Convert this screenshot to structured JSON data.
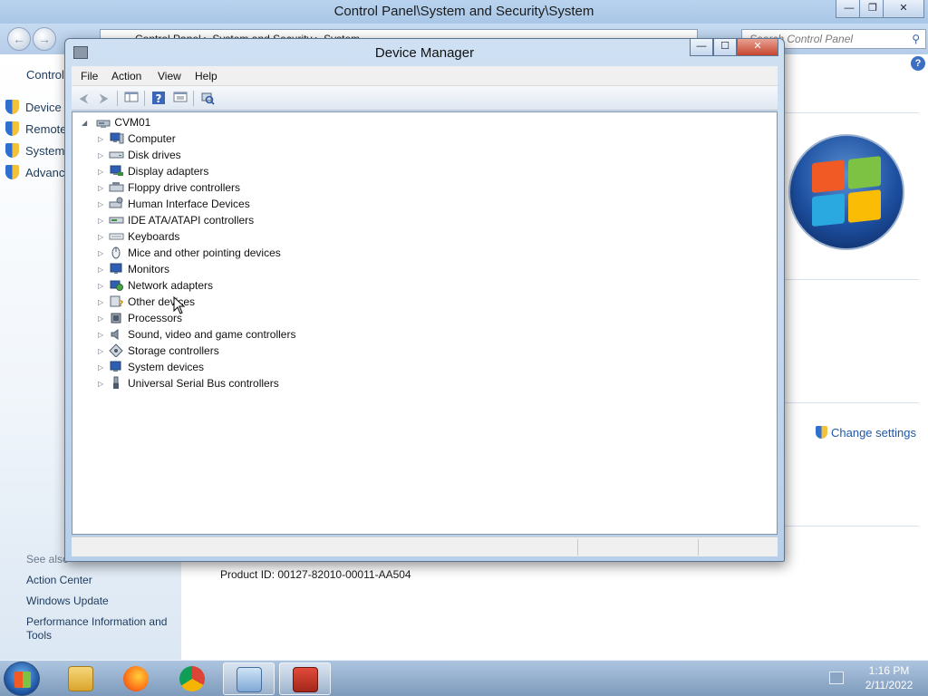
{
  "control_panel": {
    "title": "Control Panel\\System and Security\\System",
    "breadcrumb": [
      "Control Panel",
      "System and Security",
      "System"
    ],
    "search_placeholder": "Search Control Panel",
    "sidebar": {
      "home": "Control",
      "items": [
        "Device M",
        "Remote",
        "System",
        "Advanc"
      ],
      "see_also": "See also",
      "links": [
        "Action Center",
        "Windows Update",
        "Performance Information and Tools"
      ]
    },
    "change_settings": "Change settings",
    "product_id": "Product ID: 00127-82010-00011-AA504"
  },
  "device_manager": {
    "title": "Device Manager",
    "menu": [
      "File",
      "Action",
      "View",
      "Help"
    ],
    "root": "CVM01",
    "categories": [
      {
        "label": "Computer",
        "icon": "computer-icon"
      },
      {
        "label": "Disk drives",
        "icon": "disk-drive-icon"
      },
      {
        "label": "Display adapters",
        "icon": "display-adapter-icon"
      },
      {
        "label": "Floppy drive controllers",
        "icon": "floppy-controller-icon"
      },
      {
        "label": "Human Interface Devices",
        "icon": "hid-icon"
      },
      {
        "label": "IDE ATA/ATAPI controllers",
        "icon": "ide-controller-icon"
      },
      {
        "label": "Keyboards",
        "icon": "keyboard-icon"
      },
      {
        "label": "Mice and other pointing devices",
        "icon": "mouse-icon"
      },
      {
        "label": "Monitors",
        "icon": "monitor-icon"
      },
      {
        "label": "Network adapters",
        "icon": "network-adapter-icon"
      },
      {
        "label": "Other devices",
        "icon": "other-devices-icon"
      },
      {
        "label": "Processors",
        "icon": "processor-icon"
      },
      {
        "label": "Sound, video and game controllers",
        "icon": "sound-icon"
      },
      {
        "label": "Storage controllers",
        "icon": "storage-controller-icon"
      },
      {
        "label": "System devices",
        "icon": "system-devices-icon"
      },
      {
        "label": "Universal Serial Bus controllers",
        "icon": "usb-icon"
      }
    ]
  },
  "taskbar": {
    "apps": [
      "file-explorer-icon",
      "firefox-icon",
      "chrome-icon",
      "control-panel-icon",
      "device-manager-toolbox-icon"
    ],
    "time": "1:16 PM",
    "date": "2/11/2022"
  },
  "colors": {
    "link": "#1f56a8",
    "tree_text": "#111111",
    "window_frame": "#b8cfea"
  }
}
